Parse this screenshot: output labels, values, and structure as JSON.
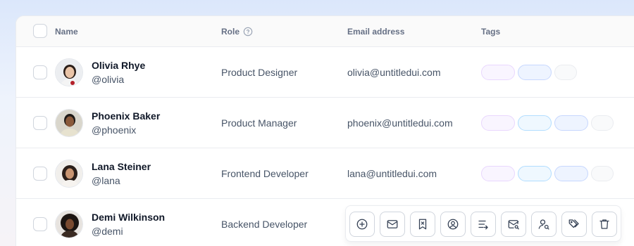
{
  "header": {
    "name_label": "Name",
    "role_label": "Role",
    "email_label": "Email address",
    "tags_label": "Tags"
  },
  "rows": [
    {
      "name": "Olivia Rhye",
      "handle": "@olivia",
      "role": "Product Designer",
      "email": "olivia@untitledui.com",
      "tags": [
        "purple",
        "indigo",
        "gray"
      ]
    },
    {
      "name": "Phoenix Baker",
      "handle": "@phoenix",
      "role": "Product Manager",
      "email": "phoenix@untitledui.com",
      "tags": [
        "purple",
        "blue",
        "indigo",
        "gray"
      ]
    },
    {
      "name": "Lana Steiner",
      "handle": "@lana",
      "role": "Frontend Developer",
      "email": "lana@untitledui.com",
      "tags": [
        "purple",
        "blue",
        "indigo",
        "gray"
      ]
    },
    {
      "name": "Demi Wilkinson",
      "handle": "@demi",
      "role": "Backend Developer",
      "email": "",
      "tags": []
    }
  ],
  "toolbar": {
    "icons": [
      "plus-circle-icon",
      "mail-icon",
      "bookmark-x-icon",
      "user-circle-icon",
      "list-arrow-icon",
      "mail-search-icon",
      "user-search-icon",
      "tags-icon",
      "trash-icon"
    ]
  },
  "colors": {
    "tag_purple": "#f9f5ff",
    "tag_indigo": "#eef4ff",
    "tag_blue": "#eff8ff",
    "tag_gray": "#f9fafb",
    "text_primary": "#101828",
    "text_secondary": "#475467"
  }
}
